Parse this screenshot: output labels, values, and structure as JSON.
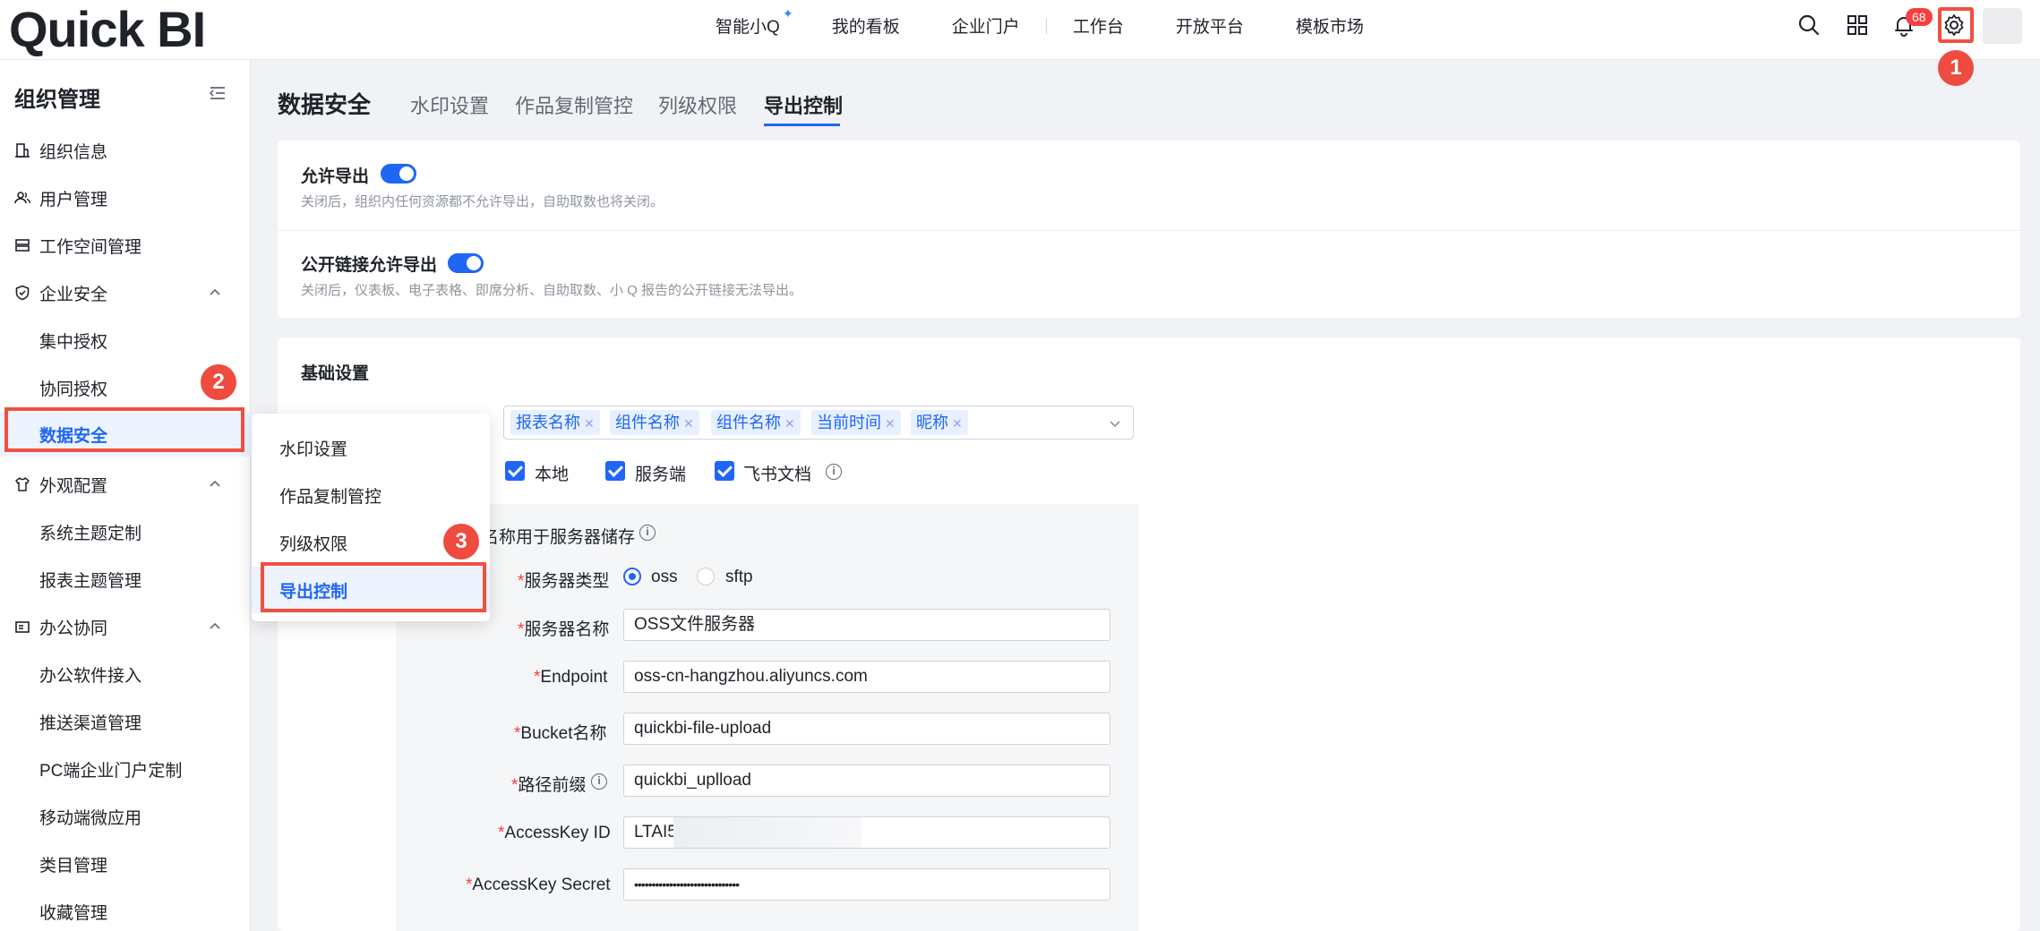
{
  "app": {
    "logo": "Quick BI"
  },
  "top_nav": {
    "items": [
      "智能小Q",
      "我的看板",
      "企业门户",
      "工作台",
      "开放平台",
      "模板市场"
    ],
    "notification_count": "68"
  },
  "markers": {
    "m1": "1",
    "m2": "2",
    "m3": "3"
  },
  "sidebar": {
    "title": "组织管理",
    "items": [
      {
        "label": "组织信息"
      },
      {
        "label": "用户管理"
      },
      {
        "label": "工作空间管理"
      },
      {
        "label": "企业安全"
      },
      {
        "label": "集中授权"
      },
      {
        "label": "协同授权"
      },
      {
        "label": "数据安全"
      },
      {
        "label": "外观配置"
      },
      {
        "label": "系统主题定制"
      },
      {
        "label": "报表主题管理"
      },
      {
        "label": "办公协同"
      },
      {
        "label": "办公软件接入"
      },
      {
        "label": "推送渠道管理"
      },
      {
        "label": "PC端企业门户定制"
      },
      {
        "label": "移动端微应用"
      },
      {
        "label": "类目管理"
      },
      {
        "label": "收藏管理"
      }
    ]
  },
  "page": {
    "title": "数据安全",
    "tabs": [
      "水印设置",
      "作品复制管控",
      "列级权限",
      "导出控制"
    ]
  },
  "export": {
    "allow_title": "允许导出",
    "allow_desc": "关闭后，组织内任何资源都不允许导出，自助取数也将关闭。",
    "public_title": "公开链接允许导出",
    "public_desc": "关闭后，仪表板、电子表格、即席分析、自助取数、小 Q 报告的公开链接无法导出。"
  },
  "basic": {
    "title": "基础设置",
    "tags": [
      "报表名称",
      "组件名称",
      "组件名称",
      "当前时间",
      "昵称"
    ],
    "targets": [
      "本地",
      "服务端",
      "飞书文档"
    ],
    "server_note": "名称用于服务器储存",
    "server_type_label": "服务器类型",
    "server_types": [
      "oss",
      "sftp"
    ],
    "server_name_label": "服务器名称",
    "server_name": "OSS文件服务器",
    "endpoint_label": "Endpoint",
    "endpoint": "oss-cn-hangzhou.aliyuncs.com",
    "bucket_label": "Bucket名称",
    "bucket": "quickbi-file-upload",
    "prefix_label": "路径前缀",
    "prefix": "quickbi_uplload",
    "ak_id_label": "AccessKey ID",
    "ak_id": "LTAI5",
    "ak_secret_label": "AccessKey Secret",
    "ak_secret": "••••••••••••••••••••••••••••••"
  },
  "popup": {
    "items": [
      "水印设置",
      "作品复制管控",
      "列级权限",
      "导出控制"
    ]
  },
  "colors": {
    "accent": "#1f66f5",
    "highlight": "#f0513f"
  }
}
